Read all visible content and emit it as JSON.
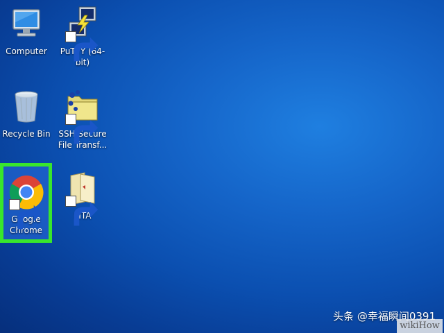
{
  "desktop": {
    "background_color": "#0b4fb0",
    "selection_highlight_color": "#39e62c",
    "icons": [
      {
        "label": "Computer",
        "icon": "computer-icon"
      },
      {
        "label": "PuTTY (64-bit)",
        "icon": "putty-icon",
        "shortcut": true
      },
      {
        "label": "Recycle Bin",
        "icon": "recycle-bin-icon"
      },
      {
        "label": "SSH Secure File Transf...",
        "icon": "ssh-secure-file-transfer-icon",
        "shortcut": true
      },
      {
        "label": "Google Chrome",
        "icon": "chrome-icon",
        "shortcut": true,
        "highlighted": true
      },
      {
        "label": "MTA",
        "icon": "folder-icon",
        "shortcut": true
      }
    ]
  },
  "watermark": {
    "text": "头条 @幸福瞬间0391",
    "brand": "wikiHow"
  }
}
